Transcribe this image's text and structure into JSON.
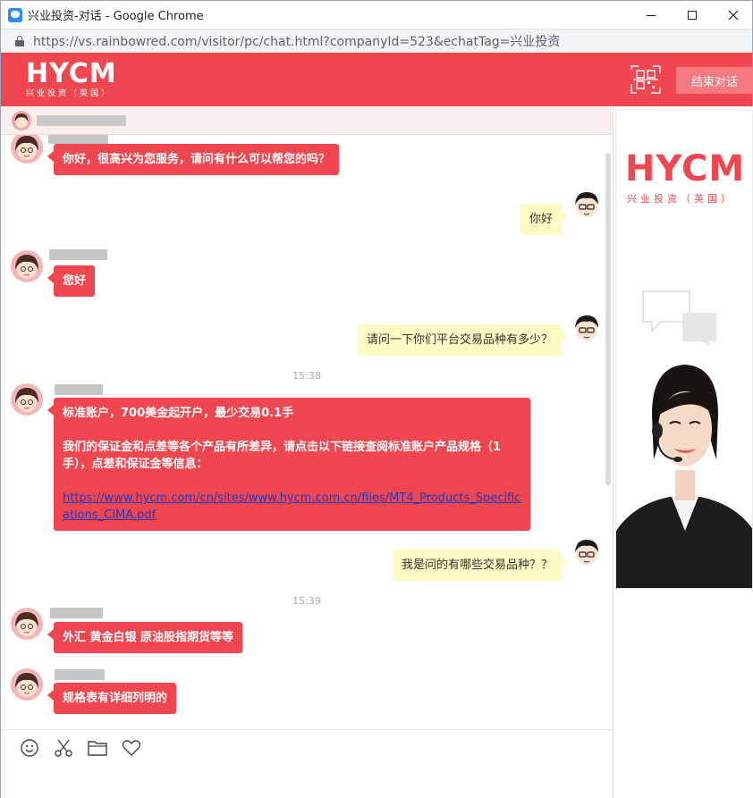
{
  "window": {
    "title": "兴业投资-对话 - Google Chrome",
    "url": "https://vs.rainbowred.com/visitor/pc/chat.html?companyId=523&echatTag=兴业投资"
  },
  "header": {
    "logo_main": "HYCM",
    "logo_sub": "兴业投资（英国）",
    "end_chat_label": "结束对话",
    "brand_color": "#f0464f"
  },
  "agent_bar": {
    "avatar_icon": "agent-avatar-icon"
  },
  "messages": [
    {
      "from": "agent",
      "text": "你好，很高兴为您服务，请问有什么可以帮您的吗？"
    },
    {
      "from": "user",
      "text": "你好"
    },
    {
      "from": "agent",
      "text": "您好"
    },
    {
      "from": "user",
      "text": "请问一下你们平台交易品种有多少？"
    },
    {
      "time": "15:38"
    },
    {
      "from": "agent",
      "line1": "标准账户，700美金起开户，最少交易0.1手",
      "line2": "我们的保证金和点差等各个产品有所差异，请点击以下链接查阅标准账户产品规格（1手），点差和保证金等信息：",
      "link": "https://www.hycm.com/cn/sites/www.hycm.com.cn/files/MT4_Products_Specifications_CIMA.pdf"
    },
    {
      "from": "user",
      "text": "我是问的有哪些交易品种？？"
    },
    {
      "time": "15:39"
    },
    {
      "from": "agent",
      "text": "外汇 黄金白银 原油股指期货等等"
    },
    {
      "from": "agent",
      "text": "规格表有详细列明的"
    }
  ],
  "toolbar": {
    "icons": [
      "emoji-icon",
      "scissors-icon",
      "folder-icon",
      "heart-icon"
    ]
  },
  "right_panel": {
    "brand_main": "HYCM",
    "brand_sub": "兴业投资（英国）"
  }
}
